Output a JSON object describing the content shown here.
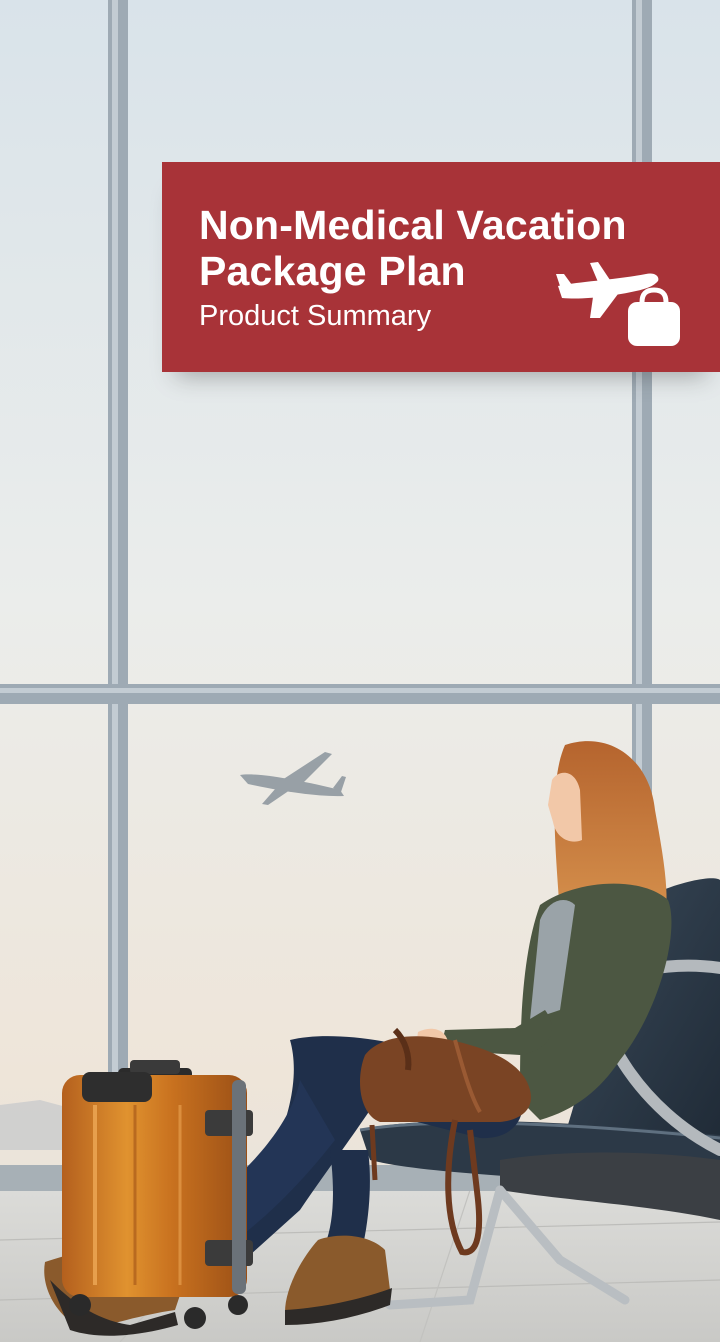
{
  "banner": {
    "title_line1": "Non-Medical Vacation",
    "title_line2": "Package Plan",
    "subtitle": "Product Summary",
    "background_color": "#a83338",
    "text_color": "#ffffff"
  },
  "icons": {
    "banner_icon": "airplane-with-suitcase-icon"
  },
  "photo": {
    "scene": "traveler-waiting-at-airport-window"
  }
}
